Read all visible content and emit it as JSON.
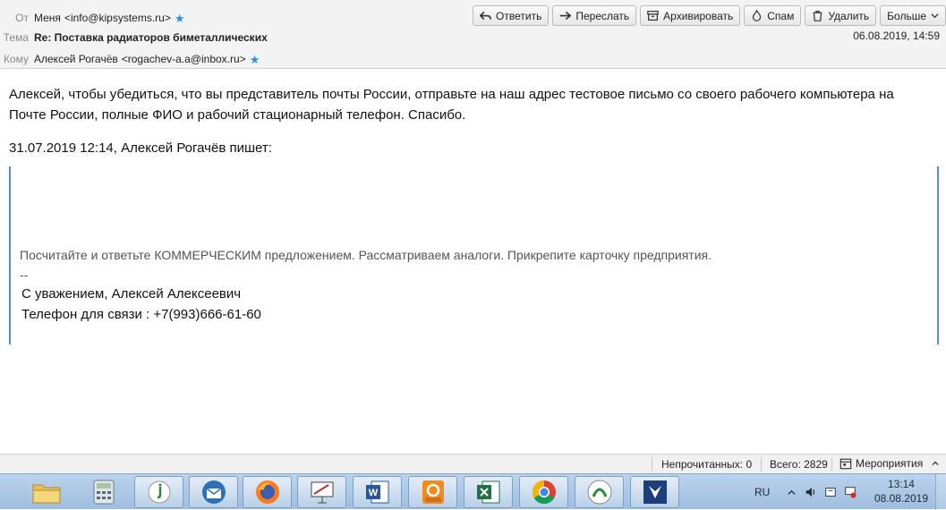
{
  "header": {
    "from_label": "От",
    "from_name": "Меня",
    "from_email": "<info@kipsystems.ru>",
    "subject_label": "Тема",
    "subject": "Re: Поставка радиаторов биметаллических",
    "to_label": "Кому",
    "to_name": "Алексей Рогачёв",
    "to_email": "<rogachev-a.a@inbox.ru>",
    "date": "06.08.2019, 14:59",
    "star_color": "#2e8fe6"
  },
  "toolbar": {
    "reply": "Ответить",
    "forward": "Переслать",
    "archive": "Архивировать",
    "spam": "Спам",
    "delete": "Удалить",
    "more": "Больше"
  },
  "message": {
    "body": "Алексей, чтобы убедиться, что вы представитель почты России, отправьте на наш адрес тестовое письмо со своего рабочего компьютера на Почте России, полные ФИО и рабочий стационарный телефон. Спасибо.",
    "attribution": "31.07.2019 12:14, Алексей Рогачёв пишет:",
    "quote_text": "Посчитайте и ответьте КОММЕРЧЕСКИМ предложением. Рассматриваем аналоги. Прикрепите карточку предприятия.",
    "quote_dashes": "--",
    "signature_line1": "С уважением, Алексей Алексеевич",
    "signature_line2": "Телефон для связи : +7(993)666-61-60",
    "quote_border_color": "#5b8cc9"
  },
  "statusbar": {
    "unread": "Непрочитанных: 0",
    "total": "Всего: 2829",
    "events": "Мероприятия"
  },
  "taskbar": {
    "apps": [
      "file-explorer-icon",
      "calculator-icon",
      "app-j-icon",
      "thunderbird-icon",
      "firefox-icon",
      "presentation-icon",
      "word-icon",
      "foxit-pdf-icon",
      "excel-icon",
      "chrome-icon",
      "green-app-icon",
      "network-app-icon"
    ],
    "language": "RU",
    "time": "13:14",
    "date": "08.08.2019"
  }
}
